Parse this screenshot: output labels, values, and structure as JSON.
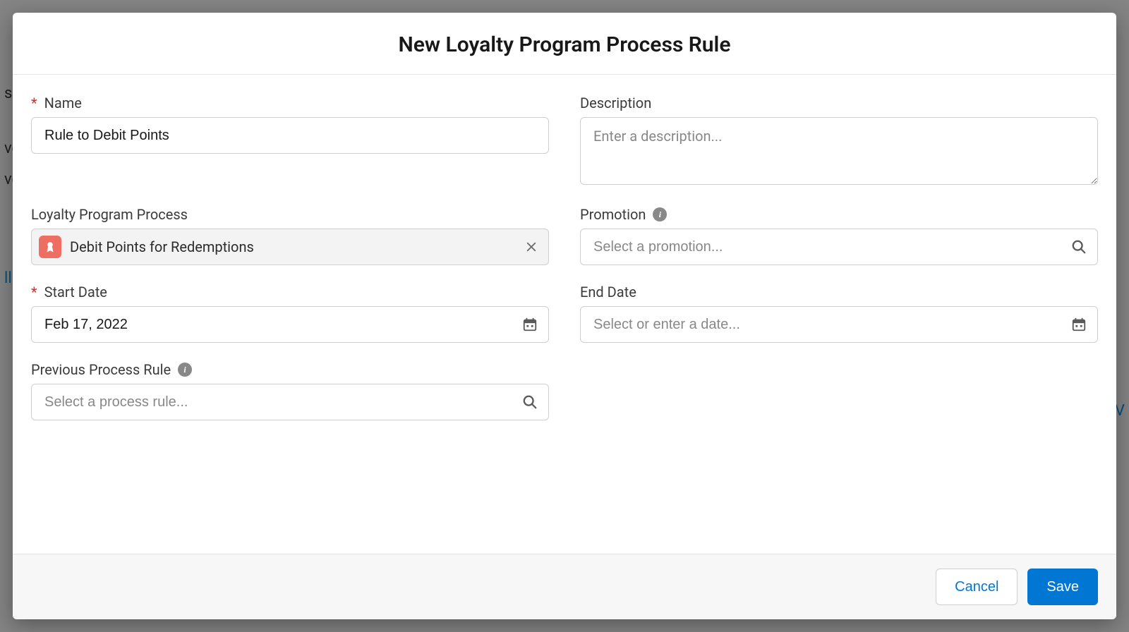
{
  "modal": {
    "title": "New Loyalty Program Process Rule"
  },
  "fields": {
    "name": {
      "label": "Name",
      "value": "Rule to Debit Points"
    },
    "description": {
      "label": "Description",
      "placeholder": "Enter a description..."
    },
    "process": {
      "label": "Loyalty Program Process",
      "selected": "Debit Points for Redemptions"
    },
    "promotion": {
      "label": "Promotion",
      "placeholder": "Select a promotion..."
    },
    "startDate": {
      "label": "Start Date",
      "value": "Feb 17, 2022"
    },
    "endDate": {
      "label": "End Date",
      "placeholder": "Select or enter a date..."
    },
    "previousRule": {
      "label": "Previous Process Rule",
      "placeholder": "Select a process rule..."
    }
  },
  "footer": {
    "cancel": "Cancel",
    "save": "Save"
  },
  "bg": {
    "t1": "s",
    "t2": "ve",
    "t3": "ve",
    "t4": "ll",
    "t5": "V"
  }
}
